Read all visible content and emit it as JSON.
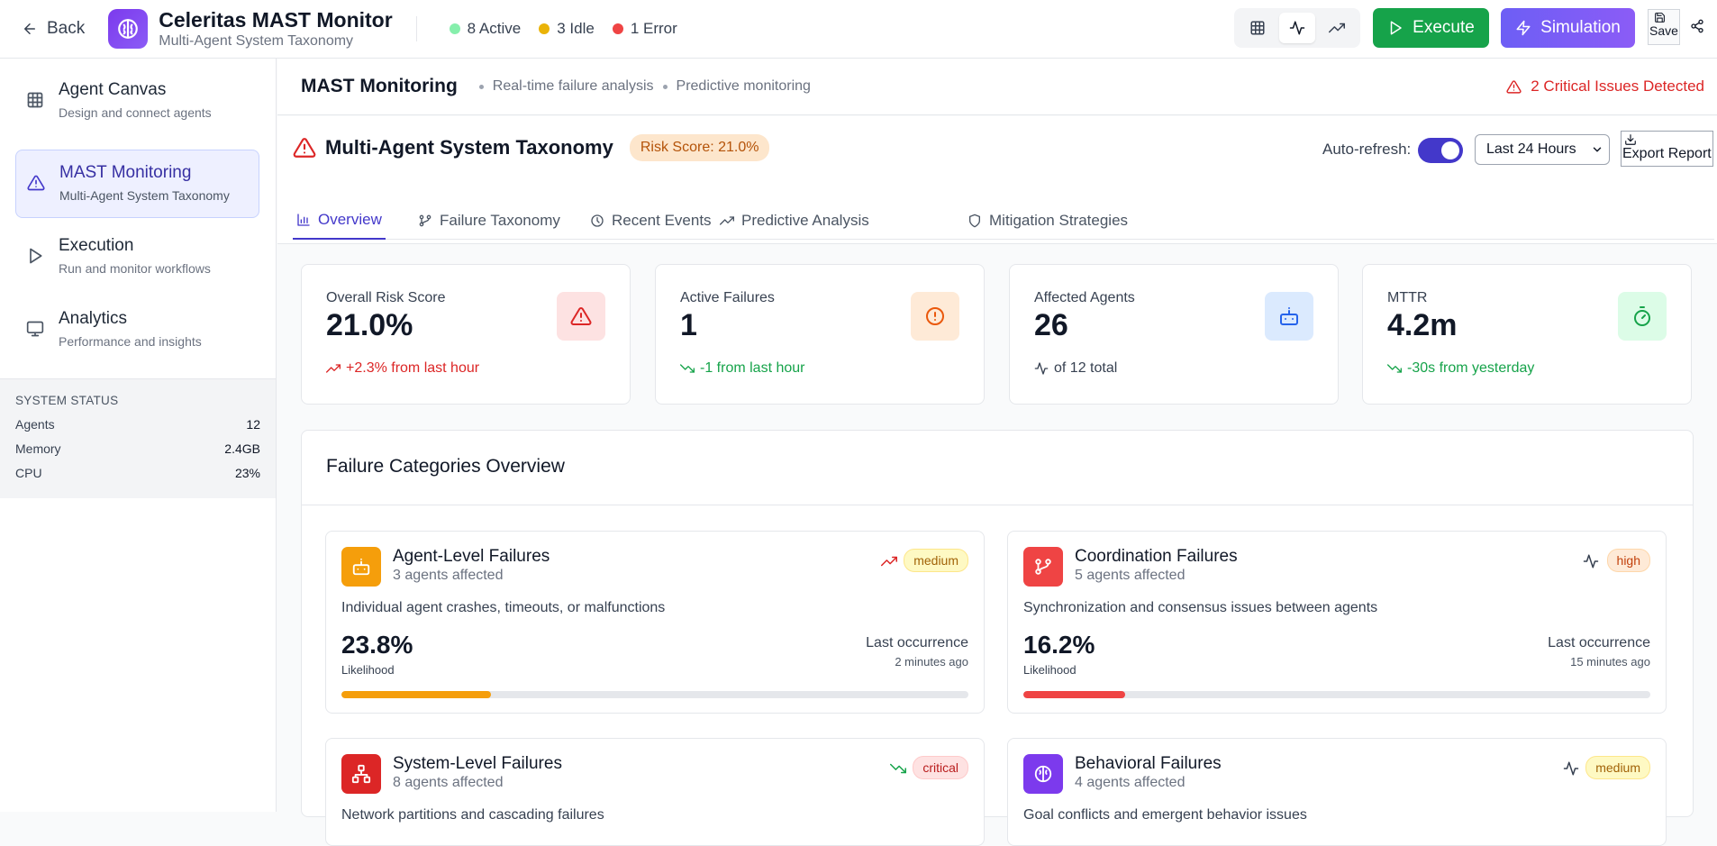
{
  "topbar": {
    "back_label": "Back",
    "app_title": "Celeritas MAST Monitor",
    "app_subtitle": "Multi-Agent System Taxonomy",
    "status": [
      {
        "label": "8 Active",
        "color": "#86efac"
      },
      {
        "label": "3 Idle",
        "color": "#eab308"
      },
      {
        "label": "1 Error",
        "color": "#ef4444"
      }
    ],
    "view_modes": [
      "grid-icon",
      "activity-icon",
      "trending-up-icon"
    ],
    "active_view": "activity-icon",
    "execute_label": "Execute",
    "simulation_label": "Simulation",
    "save_label": "Save"
  },
  "sidebar": {
    "items": [
      {
        "label": "Agent Canvas",
        "desc": "Design and connect agents",
        "icon": "grid-icon"
      },
      {
        "label": "MAST Monitoring",
        "desc": "Multi-Agent System Taxonomy",
        "icon": "alert-triangle-icon",
        "active": true
      },
      {
        "label": "Execution",
        "desc": "Run and monitor workflows",
        "icon": "play-icon"
      },
      {
        "label": "Analytics",
        "desc": "Performance and insights",
        "icon": "monitor-icon"
      }
    ],
    "system_status": {
      "heading": "SYSTEM STATUS",
      "rows": [
        {
          "label": "Agents",
          "value": "12"
        },
        {
          "label": "Memory",
          "value": "2.4GB"
        },
        {
          "label": "CPU",
          "value": "23%"
        }
      ]
    }
  },
  "main_header": {
    "title": "MAST Monitoring",
    "crumbs": [
      "Real-time failure analysis",
      "Predictive monitoring"
    ],
    "critical_text": "2 Critical Issues Detected"
  },
  "panel": {
    "title": "Multi-Agent System Taxonomy",
    "risk_badge": "Risk Score: 21.0%",
    "auto_refresh_label": "Auto-refresh:",
    "auto_refresh_on": true,
    "range_select": "Last 24 Hours",
    "export_label": "Export Report",
    "tabs": [
      {
        "label": "Overview",
        "icon": "bar-chart-icon",
        "active": true
      },
      {
        "label": "Failure Taxonomy",
        "icon": "git-branch-icon"
      },
      {
        "label": "Recent Events",
        "icon": "clock-icon"
      },
      {
        "label": "Predictive Analysis",
        "icon": "trending-up-icon"
      },
      {
        "label": "Mitigation Strategies",
        "icon": "shield-icon"
      }
    ]
  },
  "metrics": [
    {
      "label": "Overall Risk Score",
      "value": "21.0%",
      "change": "+2.3% from last hour",
      "change_color": "#dc2626",
      "icon": "alert-triangle-icon",
      "icon_color": "#dc2626",
      "icon_bg": "#fde2e2"
    },
    {
      "label": "Active Failures",
      "value": "1",
      "change": "-1 from last hour",
      "change_color": "#16a34a",
      "icon": "alert-circle-icon",
      "icon_color": "#ea580c",
      "icon_bg": "#feead7"
    },
    {
      "label": "Affected Agents",
      "value": "26",
      "change": "of 12 total",
      "change_color": "#374151",
      "icon": "bot-icon",
      "icon_color": "#2563eb",
      "icon_bg": "#dbeafe"
    },
    {
      "label": "MTTR",
      "value": "4.2m",
      "change": "-30s from yesterday",
      "change_color": "#16a34a",
      "icon": "timer-icon",
      "icon_color": "#16a34a",
      "icon_bg": "#dcfce7"
    }
  ],
  "failure_overview": {
    "heading": "Failure Categories Overview",
    "likelihood_label": "Likelihood",
    "last_occurrence_label": "Last occurrence",
    "categories": [
      {
        "name": "Agent-Level Failures",
        "affected": "3 agents affected",
        "desc": "Individual agent crashes, timeouts, or malfunctions",
        "likelihood": "23.8%",
        "likelihood_value": 0.238,
        "last": "2 minutes ago",
        "severity": "medium",
        "trend": "trending-up-icon",
        "color": "#f59e0b",
        "icon": "bot-icon"
      },
      {
        "name": "Coordination Failures",
        "affected": "5 agents affected",
        "desc": "Synchronization and consensus issues between agents",
        "likelihood": "16.2%",
        "likelihood_value": 0.162,
        "last": "15 minutes ago",
        "severity": "high",
        "trend": "activity-icon",
        "color": "#ef4444",
        "icon": "git-branch-icon"
      },
      {
        "name": "System-Level Failures",
        "affected": "8 agents affected",
        "desc": "Network partitions and cascading failures",
        "severity": "critical",
        "trend": "trending-down-icon",
        "color": "#dc2626",
        "icon": "network-icon"
      },
      {
        "name": "Behavioral Failures",
        "affected": "4 agents affected",
        "desc": "Goal conflicts and emergent behavior issues",
        "severity": "medium",
        "trend": "activity-icon",
        "color": "#7c3aed",
        "icon": "brain-icon"
      }
    ]
  }
}
